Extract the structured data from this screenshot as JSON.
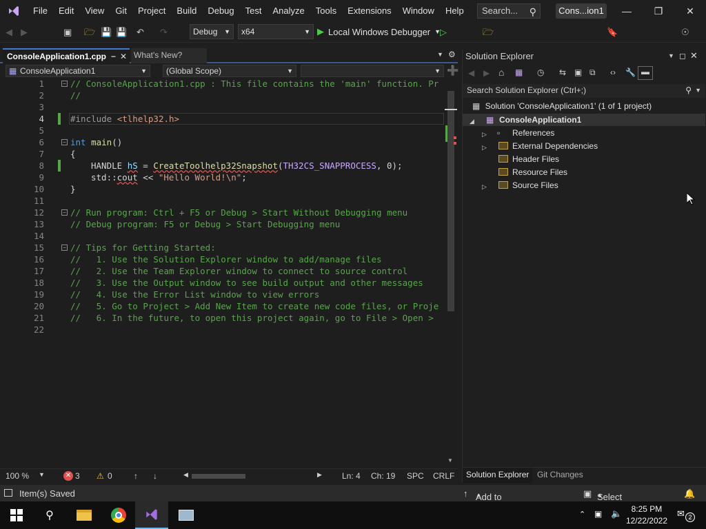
{
  "menu": {
    "items": [
      "File",
      "Edit",
      "View",
      "Git",
      "Project",
      "Build",
      "Debug",
      "Test",
      "Analyze",
      "Tools",
      "Extensions",
      "Window",
      "Help"
    ],
    "search_placeholder": "Search...",
    "title": "Cons...ion1"
  },
  "toolbar": {
    "config": "Debug",
    "platform": "x64",
    "run_label": "Local Windows Debugger"
  },
  "tabs": {
    "active": "ConsoleApplication1.cpp",
    "inactive": "What's New?"
  },
  "navbar": {
    "project": "ConsoleApplication1",
    "scope": "(Global Scope)"
  },
  "editor": {
    "line_numbers": [
      "1",
      "2",
      "3",
      "4",
      "5",
      "6",
      "7",
      "8",
      "9",
      "10",
      "11",
      "12",
      "13",
      "14",
      "15",
      "16",
      "17",
      "18",
      "19",
      "20",
      "21",
      "22"
    ],
    "lines": {
      "l1": "// ConsoleApplication1.cpp : This file contains the 'main' function. Pr",
      "l2": "//",
      "l4_a": "#include ",
      "l4_b": "<tlhelp32.h>",
      "l6_kw": "int",
      "l6_fn": "main",
      "l6_rest": "()",
      "l7": "{",
      "l8_type": "HANDLE",
      "l8_var": "hS",
      "l8_eq": " = ",
      "l8_fn": "CreateToolhelp32Snapshot",
      "l8_open": "(",
      "l8_enum": "TH32CS_SNAPPROCESS",
      "l8_rest": ", 0);",
      "l9_a": "std::",
      "l9_b": "cout",
      "l9_c": " << ",
      "l9_str": "\"Hello World!\\n\"",
      "l9_end": ";",
      "l10": "}",
      "l12": "// Run program: Ctrl + F5 or Debug > Start Without Debugging menu",
      "l13": "// Debug program: F5 or Debug > Start Debugging menu",
      "l15": "// Tips for Getting Started:",
      "l16": "//   1. Use the Solution Explorer window to add/manage files",
      "l17": "//   2. Use the Team Explorer window to connect to source control",
      "l18": "//   3. Use the Output window to see build output and other messages",
      "l19": "//   4. Use the Error List window to view errors",
      "l20": "//   5. Go to Project > Add New Item to create new code files, or Proje",
      "l21": "//   6. In the future, to open this project again, go to File > Open >"
    }
  },
  "editor_status": {
    "zoom": "100 %",
    "errors": "3",
    "warnings": "0",
    "ln": "Ln: 4",
    "ch": "Ch: 19",
    "spc": "SPC",
    "crlf": "CRLF"
  },
  "solution_explorer": {
    "title": "Solution Explorer",
    "search": "Search Solution Explorer (Ctrl+;)",
    "solution": "Solution 'ConsoleApplication1' (1 of 1 project)",
    "project": "ConsoleApplication1",
    "items": [
      "References",
      "External Dependencies",
      "Header Files",
      "Resource Files",
      "Source Files"
    ],
    "tab_active": "Solution Explorer",
    "tab_inactive": "Git Changes"
  },
  "statusbar": {
    "message": "Item(s) Saved",
    "source_control": "Add to Source Control",
    "repo": "Select Repository"
  },
  "taskbar": {
    "time": "8:25 PM",
    "date": "12/22/2022",
    "notifications": "2"
  },
  "colors": {
    "accent": "#3c7dd4",
    "comment": "#57a64a",
    "keyword": "#569cd6",
    "string": "#d69d85",
    "function": "#dcdcaa",
    "error": "#e05252"
  }
}
